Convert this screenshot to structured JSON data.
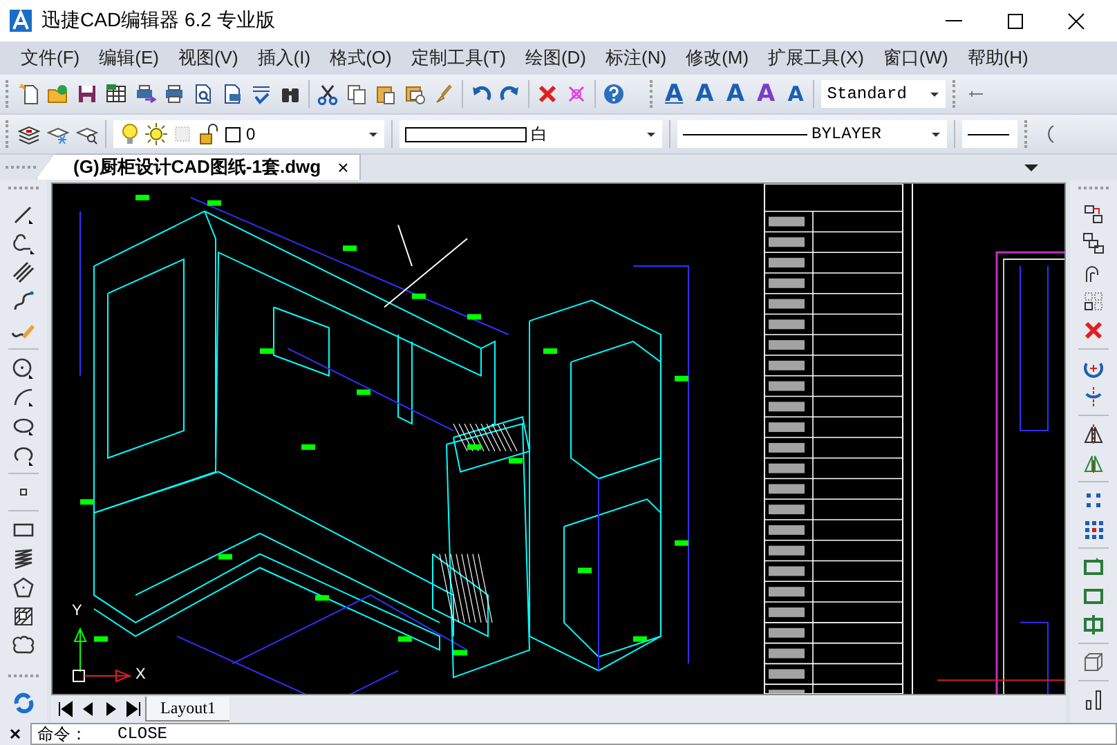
{
  "window": {
    "title": "迅捷CAD编辑器 6.2 专业版"
  },
  "menu": [
    "文件(F)",
    "编辑(E)",
    "视图(V)",
    "插入(I)",
    "格式(O)",
    "定制工具(T)",
    "绘图(D)",
    "标注(N)",
    "修改(M)",
    "扩展工具(X)",
    "窗口(W)",
    "帮助(H)"
  ],
  "text_tools": [
    {
      "glyph": "A",
      "kind": "underline"
    },
    {
      "glyph": "A",
      "kind": "plain"
    },
    {
      "glyph": "A",
      "kind": "doc"
    },
    {
      "glyph": "A",
      "kind": "pen"
    },
    {
      "glyph": "A",
      "kind": "search"
    }
  ],
  "text_style": {
    "value": "Standard"
  },
  "layer": {
    "value": "0"
  },
  "color": {
    "value": "白"
  },
  "linetype": {
    "value": "BYLAYER"
  },
  "document_tab": {
    "label": "(G)厨柜设计CAD图纸-1套.dwg",
    "close": "×",
    "selected": true
  },
  "ucs": {
    "x_label": "X",
    "y_label": "Y"
  },
  "layout_tabs": [
    {
      "label": "Layout1",
      "selected": false
    }
  ],
  "command": {
    "prompt": "命令：",
    "value": "CLOSE"
  }
}
